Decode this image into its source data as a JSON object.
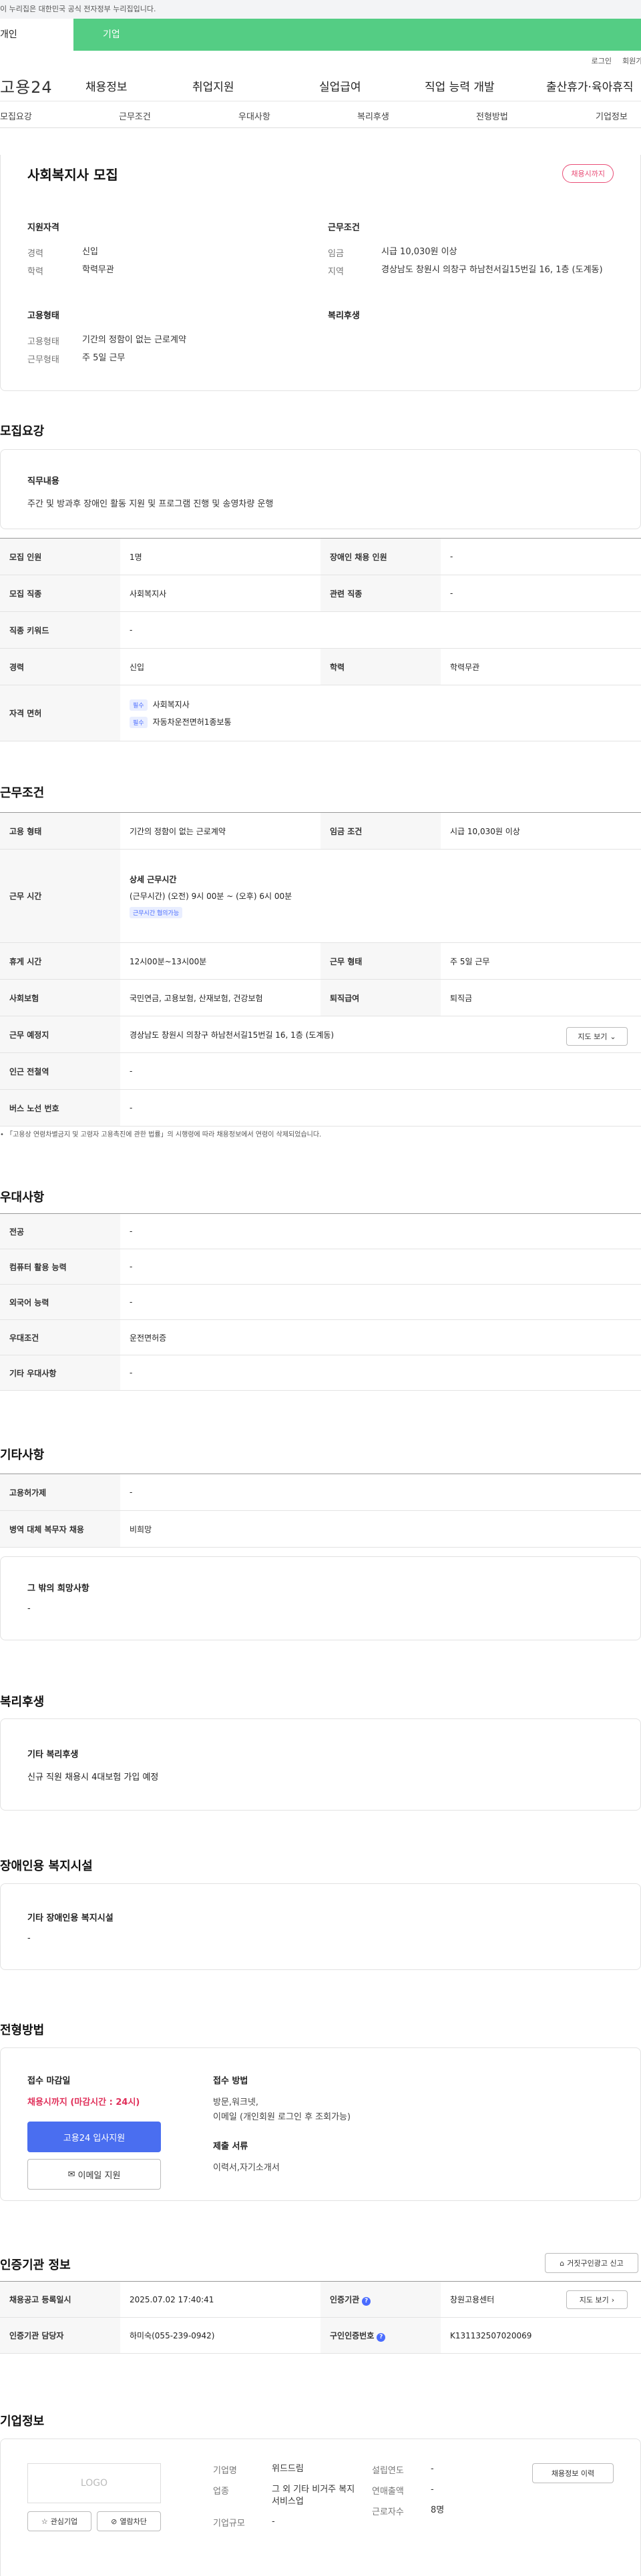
{
  "gov_banner": "이 누리집은 대한민국 공식 전자정부 누리집입니다.",
  "user_tabs": [
    "개인",
    "기업"
  ],
  "top_links": [
    "로그인",
    "회원가입"
  ],
  "brand": "고용24",
  "gnb": [
    "채용정보",
    "취업지원",
    "실업급여",
    "직업 능력 개발",
    "출산휴가·육아휴직"
  ],
  "tabs": [
    "모집요강",
    "근무조건",
    "우대사항",
    "복리후생",
    "전형방법",
    "기업정보"
  ],
  "job": {
    "title": "사회복지사 모집",
    "badge": "채용시까지",
    "qual_title": "지원자격",
    "cond_title": "근무조건",
    "career_k": "경력",
    "career_v": "신입",
    "edu_k": "학력",
    "edu_v": "학력무관",
    "wage_k": "임금",
    "wage_v": "시급 10,030원 이상",
    "area_k": "지역",
    "area_v": "경상남도 창원시 의창구 하남천서길15번길 16, 1층 (도계동)",
    "emp_title": "고용형태",
    "welfare_title": "복리후생",
    "type_k": "고용형태",
    "type_v": "기간의 정함이 없는 근로계약",
    "form_k": "근무형태",
    "form_v": "주 5일 근무"
  },
  "recruit": {
    "title": "모집요강",
    "duty_title": "직무내용",
    "duty": "주간 및 방과후 장애인 활동 지원 및 프로그램 진행 및 송영차량 운행",
    "rows": [
      [
        "모집 인원",
        "1명",
        "장애인 채용 인원",
        "-"
      ],
      [
        "모집 직종",
        "사회복지사",
        "관련 직종",
        "-"
      ],
      [
        "직종 키워드",
        "-"
      ],
      [
        "경력",
        "신입",
        "학력",
        "학력무관"
      ]
    ],
    "license_k": "자격 면허",
    "req": "필수",
    "lic1": "사회복지사",
    "lic2": "자동차운전면허1종보통"
  },
  "work": {
    "title": "근무조건",
    "type_k": "고용 형태",
    "type_v": "기간의 정함이 없는 근로계약",
    "wage_k": "임금 조건",
    "wage_v": "시급 10,030원 이상",
    "time_k": "근무 시간",
    "time_title": "상세 근무시간",
    "time_v": "(근무시간) (오전) 9시 00분 ~ (오후) 6시 00분",
    "time_tag": "근무시간 협의가능",
    "rest_k": "휴게 시간",
    "rest_v": "12시00분~13시00분",
    "shape_k": "근무 형태",
    "shape_v": "주 5일 근무",
    "ins_k": "사회보험",
    "ins_v": "국민연금, 고용보험, 산재보험, 건강보험",
    "ret_k": "퇴직급여",
    "ret_v": "퇴직금",
    "place_k": "근무 예정지",
    "place_v": "경상남도 창원시 의창구 하남천서길15번길 16, 1층 (도계동)",
    "map_btn": "지도 보기",
    "sub_k": "인근 전철역",
    "sub_v": "-",
    "bus_k": "버스 노선 번호",
    "bus_v": "-",
    "note": "「고용상 연령차별금지 및 고령자 고용촉진에 관한 법률」의 시행령에 따라 채용정보에서 연령이 삭제되었습니다."
  },
  "pref": {
    "title": "우대사항",
    "rows": [
      [
        "전공",
        "-"
      ],
      [
        "컴퓨터 활용 능력",
        "-"
      ],
      [
        "외국어 능력",
        "-"
      ],
      [
        "우대조건",
        "운전면허증"
      ],
      [
        "기타 우대사항",
        "-"
      ]
    ]
  },
  "etc": {
    "title": "기타사항",
    "rows": [
      [
        "고용허가제",
        "-"
      ],
      [
        "병역 대체 복무자 채용",
        "비희망"
      ]
    ],
    "other_title": "그 밖의 희망사항",
    "other_v": "-"
  },
  "welfare": {
    "title": "복리후생",
    "sub": "기타 복리후생",
    "v": "신규 직원 채용시 4대보험 가입 예정"
  },
  "disabled": {
    "title": "장애인용 복지시설",
    "sub": "기타 장애인용 복지시설",
    "v": "-"
  },
  "process": {
    "title": "전형방법",
    "deadline_title": "접수 마감일",
    "deadline": "채용시까지 (마감시간 : 24시)",
    "apply_btn": "고용24 입사지원",
    "email_btn": "이메일 지원",
    "method_title": "접수 방법",
    "method1": "방문,워크넷,",
    "method2": "이메일 (개인회원 로그인 후 조회가능)",
    "docs_title": "제출 서류",
    "docs": "이력서,자기소개서"
  },
  "cert": {
    "title": "인증기관 정보",
    "report_btn": "거짓구인광고 신고",
    "date_k": "채용공고 등록일시",
    "date_v": "2025.07.02 17:40:41",
    "org_k": "인증기관",
    "org_v": "창원고용센터",
    "map_btn": "지도 보기",
    "mgr_k": "인증기관 담당자",
    "mgr_v": "하미숙(055-239-0942)",
    "no_k": "구인인증번호",
    "no_v": "K131132507020069"
  },
  "company": {
    "title": "기업정보",
    "logo": "LOGO",
    "fav_btn": "관심기업",
    "block_btn": "열람차단",
    "history_btn": "채용정보 이력",
    "name_k": "기업명",
    "name_v": "위드드림",
    "ind_k": "업종",
    "ind_v": "그 외 기타 비거주 복지 서비스업",
    "scale_k": "기업규모",
    "scale_v": "-",
    "year_k": "설립연도",
    "year_v": "-",
    "sales_k": "연매출액",
    "sales_v": "-",
    "emp_k": "근로자수",
    "emp_v": "8명"
  }
}
